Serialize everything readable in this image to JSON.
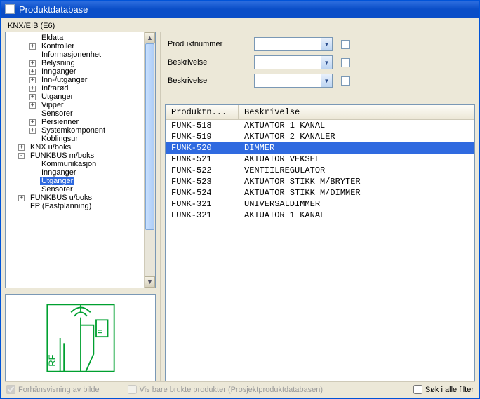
{
  "window": {
    "title": "Produktdatabase"
  },
  "groupLabel": "KNX/EIB (E6)",
  "tree": [
    {
      "label": "Eldata",
      "depth": 2,
      "exp": ""
    },
    {
      "label": "Kontroller",
      "depth": 2,
      "exp": "+"
    },
    {
      "label": "Informasjonenhet",
      "depth": 2,
      "exp": ""
    },
    {
      "label": "Belysning",
      "depth": 2,
      "exp": "+"
    },
    {
      "label": "Innganger",
      "depth": 2,
      "exp": "+"
    },
    {
      "label": "Inn-/utganger",
      "depth": 2,
      "exp": "+"
    },
    {
      "label": "Infrarød",
      "depth": 2,
      "exp": "+"
    },
    {
      "label": "Utganger",
      "depth": 2,
      "exp": "+"
    },
    {
      "label": "Vipper",
      "depth": 2,
      "exp": "+"
    },
    {
      "label": "Sensorer",
      "depth": 2,
      "exp": ""
    },
    {
      "label": "Persienner",
      "depth": 2,
      "exp": "+"
    },
    {
      "label": "Systemkomponent",
      "depth": 2,
      "exp": "+"
    },
    {
      "label": "Koblingsur",
      "depth": 2,
      "exp": ""
    },
    {
      "label": "KNX u/boks",
      "depth": 1,
      "exp": "+"
    },
    {
      "label": "FUNKBUS m/boks",
      "depth": 1,
      "exp": "-"
    },
    {
      "label": "Kommunikasjon",
      "depth": 2,
      "exp": ""
    },
    {
      "label": "Innganger",
      "depth": 2,
      "exp": ""
    },
    {
      "label": "Utganger",
      "depth": 2,
      "exp": "",
      "selected": true
    },
    {
      "label": "Sensorer",
      "depth": 2,
      "exp": ""
    },
    {
      "label": "FUNKBUS u/boks",
      "depth": 1,
      "exp": "+"
    },
    {
      "label": "FP (Fastplanning)",
      "depth": 1,
      "exp": ""
    }
  ],
  "filters": {
    "rows": [
      {
        "label": "Produktnummer"
      },
      {
        "label": "Beskrivelse"
      },
      {
        "label": "Beskrivelse"
      }
    ]
  },
  "table": {
    "headers": {
      "col1": "Produktn...",
      "col2": "Beskrivelse"
    },
    "rows": [
      {
        "c1": "FUNK-518",
        "c2": "AKTUATOR 1 KANAL"
      },
      {
        "c1": "FUNK-519",
        "c2": "AKTUATOR 2 KANALER"
      },
      {
        "c1": "FUNK-520",
        "c2": "DIMMER",
        "selected": true
      },
      {
        "c1": "FUNK-521",
        "c2": "AKTUATOR VEKSEL"
      },
      {
        "c1": "FUNK-522",
        "c2": "VENTIILREGULATOR"
      },
      {
        "c1": "FUNK-523",
        "c2": "AKTUATOR STIKK M/BRYTER"
      },
      {
        "c1": "FUNK-524",
        "c2": "AKTUATOR STIKK M/DIMMER"
      },
      {
        "c1": "FUNK-321",
        "c2": "UNIVERSALDIMMER"
      },
      {
        "c1": "FUNK-321",
        "c2": "AKTUATOR 1 KANAL"
      }
    ]
  },
  "footer": {
    "preview": "Forhånsvisning av bilde",
    "usedOnly": "Vis bare brukte produkter (Prosjektproduktdatabasen)",
    "searchAll": "Søk i alle filter"
  }
}
